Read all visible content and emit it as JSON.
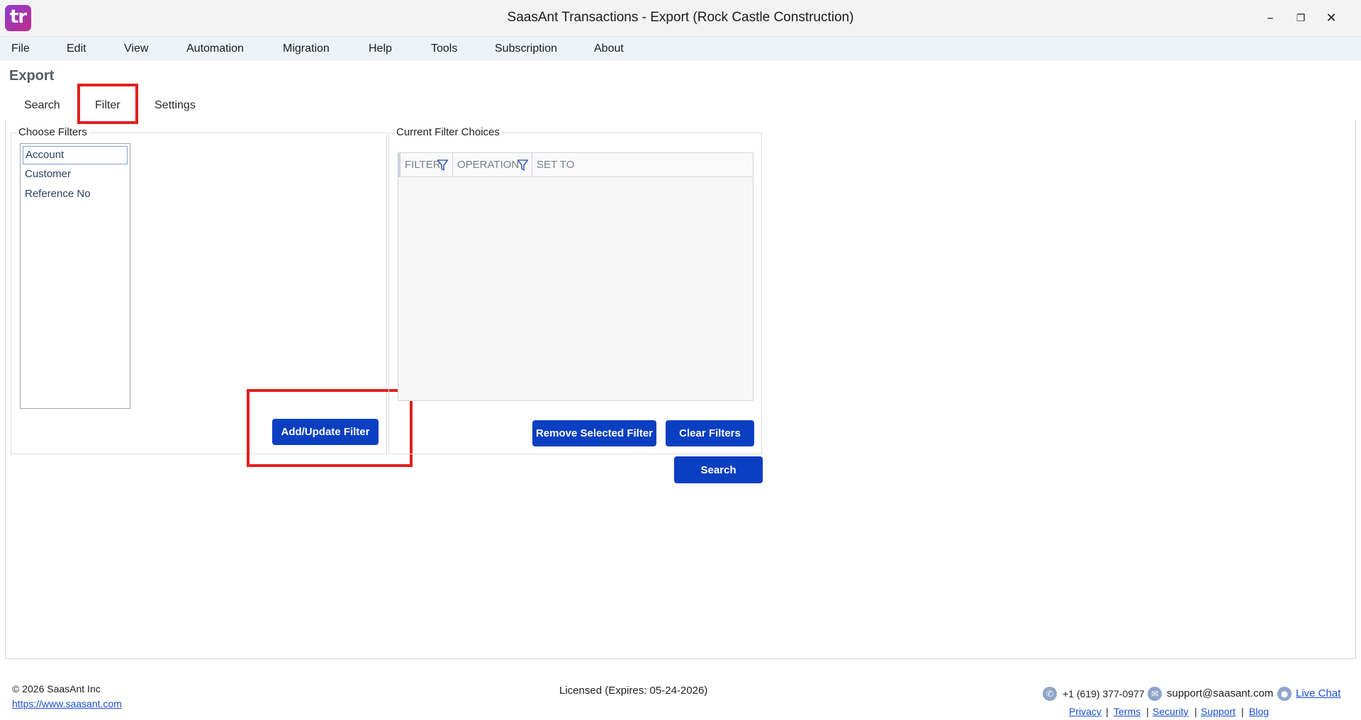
{
  "window": {
    "title": "SaasAnt Transactions - Export (Rock Castle Construction)",
    "logo_text": "tr",
    "minimize": "–",
    "maximize": "❐",
    "close": "✕"
  },
  "menu": [
    "File",
    "Edit",
    "View",
    "Automation",
    "Migration",
    "Help",
    "Tools",
    "Subscription",
    "About"
  ],
  "page_title": "Export",
  "tabs": [
    "Search",
    "Filter",
    "Settings"
  ],
  "active_tab": "Filter",
  "choose_filters": {
    "label": "Choose Filters",
    "items": [
      "Account",
      "Customer",
      "Reference No"
    ],
    "selected": "Account",
    "add_button": "Add/Update Filter"
  },
  "current_filters": {
    "label": "Current Filter Choices",
    "columns": [
      "FILTER",
      "OPERATION",
      "SET TO"
    ],
    "rows": [],
    "remove_button": "Remove Selected Filter",
    "clear_button": "Clear Filters"
  },
  "search_button": "Search",
  "footer": {
    "copyright": "©  2026  SaasAnt Inc",
    "website": "https://www.saasant.com",
    "license": "Licensed  (Expires: 05-24-2026)",
    "phone": "+1 (619) 377-0977",
    "email": "support@saasant.com",
    "live_chat": "Live Chat",
    "links": [
      "Privacy",
      "Terms",
      "Security",
      "Support",
      "Blog"
    ]
  },
  "colors": {
    "primary_button": "#0b3fc1",
    "highlight_box": "#e2201f",
    "menubar_bg": "#eef3fa"
  }
}
